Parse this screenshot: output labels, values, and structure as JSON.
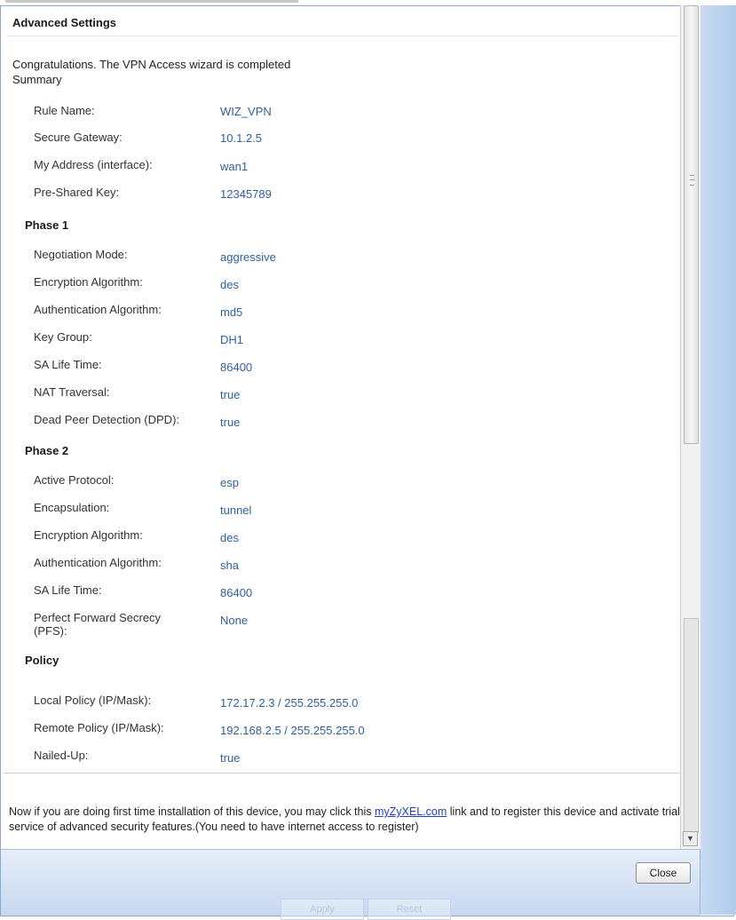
{
  "dialog": {
    "section_title": "Advanced Settings",
    "congrats": "Congratulations. The VPN Access wizard is completed",
    "summary_label": "Summary"
  },
  "general": [
    {
      "label": "Rule Name:",
      "value": "WIZ_VPN"
    },
    {
      "label": "Secure Gateway:",
      "value": "10.1.2.5"
    },
    {
      "label": "My Address (interface):",
      "value": "wan1"
    },
    {
      "label": "Pre-Shared Key:",
      "value": "12345789"
    }
  ],
  "phase1": {
    "title": "Phase 1",
    "rows": [
      {
        "label": "Negotiation Mode:",
        "value": "aggressive"
      },
      {
        "label": "Encryption Algorithm:",
        "value": "des"
      },
      {
        "label": "Authentication Algorithm:",
        "value": "md5"
      },
      {
        "label": "Key Group:",
        "value": "DH1"
      },
      {
        "label": "SA Life Time:",
        "value": "86400"
      },
      {
        "label": "NAT Traversal:",
        "value": "true"
      },
      {
        "label": "Dead Peer Detection (DPD):",
        "value": "true"
      }
    ]
  },
  "phase2": {
    "title": "Phase 2",
    "rows": [
      {
        "label": "Active Protocol:",
        "value": "esp"
      },
      {
        "label": "Encapsulation:",
        "value": "tunnel"
      },
      {
        "label": "Encryption Algorithm:",
        "value": "des"
      },
      {
        "label": "Authentication Algorithm:",
        "value": "sha"
      },
      {
        "label": "SA Life Time:",
        "value": "86400"
      },
      {
        "label": "Perfect Forward Secrecy (PFS):",
        "value": "None"
      }
    ]
  },
  "policy": {
    "title": "Policy",
    "rows": [
      {
        "label": "Local Policy (IP/Mask):",
        "value": "172.17.2.3 / 255.255.255.0"
      },
      {
        "label": "Remote Policy (IP/Mask):",
        "value": "192.168.2.5 / 255.255.255.0"
      },
      {
        "label": "Nailed-Up:",
        "value": "true"
      }
    ]
  },
  "note": {
    "before": "Now if you are doing first time installation of this device, you may click this ",
    "link": "myZyXEL.com",
    "after": " link and to register this device and activate trial service of advanced security features.(You need to have internet access to register)"
  },
  "buttons": {
    "close": "Close",
    "ghost_apply": "Apply",
    "ghost_reset": "Reset"
  },
  "colors": {
    "value_text": "#2f5f9f",
    "link": "#1f3fbf",
    "footer": "#c6d8f0",
    "side_panel": "#b1cbea"
  }
}
